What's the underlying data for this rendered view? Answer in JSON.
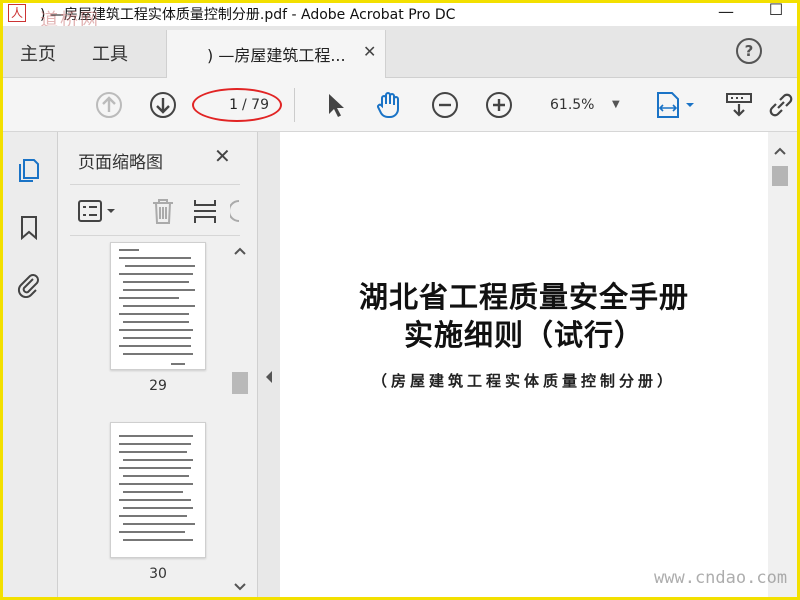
{
  "window": {
    "title": ") —房屋建筑工程实体质量控制分册.pdf - Adobe Acrobat Pro DC",
    "minimize_glyph": "—",
    "maximize_glyph": "☐"
  },
  "tabs": {
    "home_label": "主页",
    "tools_label": "工具",
    "doc_tab_label": ") —房屋建筑工程...",
    "close_glyph": "✕",
    "help_glyph": "?"
  },
  "toolbar": {
    "current_page": "1",
    "total_pages": "/ 79",
    "zoom": "61.5%",
    "zoom_caret": "▼",
    "accent_color": "#1a73c6",
    "highlight_color": "#e12424"
  },
  "thumbnail_panel": {
    "title": "页面缩略图",
    "close_glyph": "✕",
    "pages": [
      {
        "number": "29"
      },
      {
        "number": "30"
      }
    ]
  },
  "document": {
    "title_line1": "湖北省工程质量安全手册",
    "title_line2": "实施细则（试行）",
    "subtitle": "（房屋建筑工程实体质量控制分册）"
  },
  "watermarks": {
    "top_left": "道桥网",
    "bottom_right": "www.cndao.com"
  }
}
